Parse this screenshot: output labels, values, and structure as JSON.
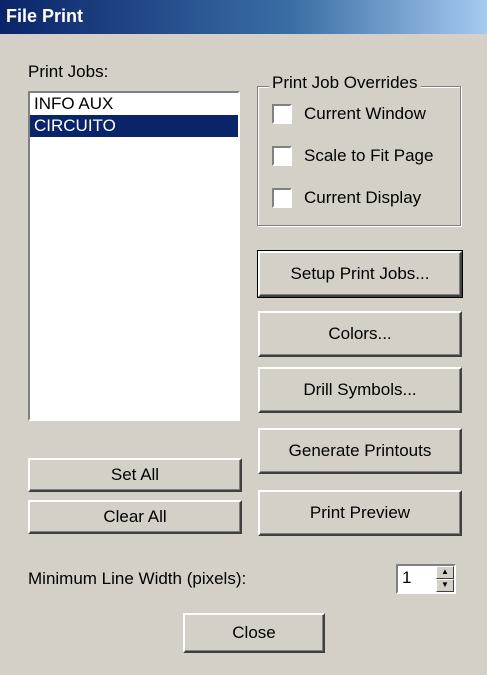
{
  "window": {
    "title": "File Print"
  },
  "print_jobs": {
    "label": "Print Jobs:",
    "items": [
      {
        "label": "INFO AUX",
        "selected": false
      },
      {
        "label": "CIRCUITO",
        "selected": true
      }
    ]
  },
  "overrides": {
    "legend": "Print Job Overrides",
    "options": [
      {
        "label": "Current Window",
        "checked": false
      },
      {
        "label": "Scale to Fit Page",
        "checked": false
      },
      {
        "label": "Current Display",
        "checked": false
      }
    ]
  },
  "buttons": {
    "setup_print_jobs": "Setup Print Jobs...",
    "colors": "Colors...",
    "drill_symbols": "Drill Symbols...",
    "generate_printouts": "Generate Printouts",
    "set_all": "Set All",
    "clear_all": "Clear All",
    "print_preview": "Print Preview",
    "close": "Close"
  },
  "min_line_width": {
    "label": "Minimum Line Width (pixels):",
    "value": "1"
  },
  "icons": {
    "spin_up": "spin-up-arrow-icon",
    "spin_down": "spin-down-arrow-icon"
  },
  "colors": {
    "title_bar": "#0a246a",
    "face": "#d4d0c8",
    "selection": "#0a246a"
  }
}
